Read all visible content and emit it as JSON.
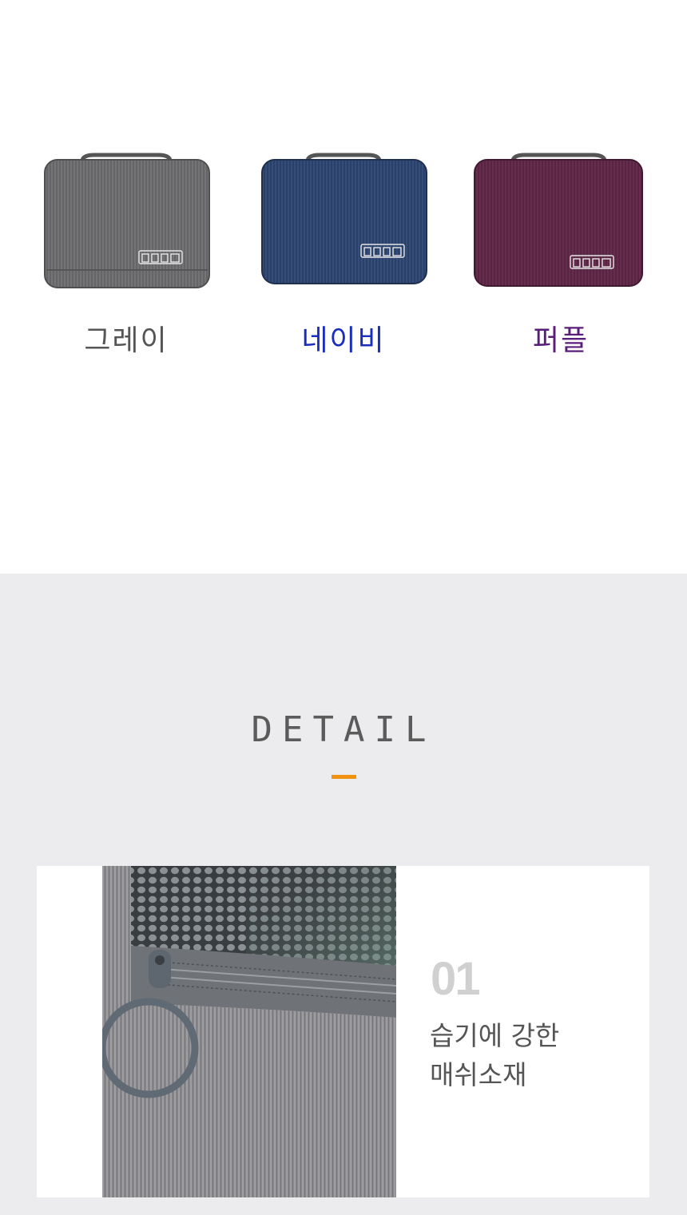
{
  "colors_section": {
    "options": [
      {
        "label": "그레이",
        "text_color": "#555555",
        "bag_color": "#6b6b6d"
      },
      {
        "label": "네이비",
        "text_color": "#1a2dbf",
        "bag_color": "#2e4570"
      },
      {
        "label": "퍼플",
        "text_color": "#5a1e7a",
        "bag_color": "#5e2846"
      }
    ]
  },
  "detail": {
    "title": "DETAIL",
    "accent_color": "#f0920f",
    "feature": {
      "number": "01",
      "line1": "습기에 강한",
      "line2": "매쉬소재"
    }
  }
}
